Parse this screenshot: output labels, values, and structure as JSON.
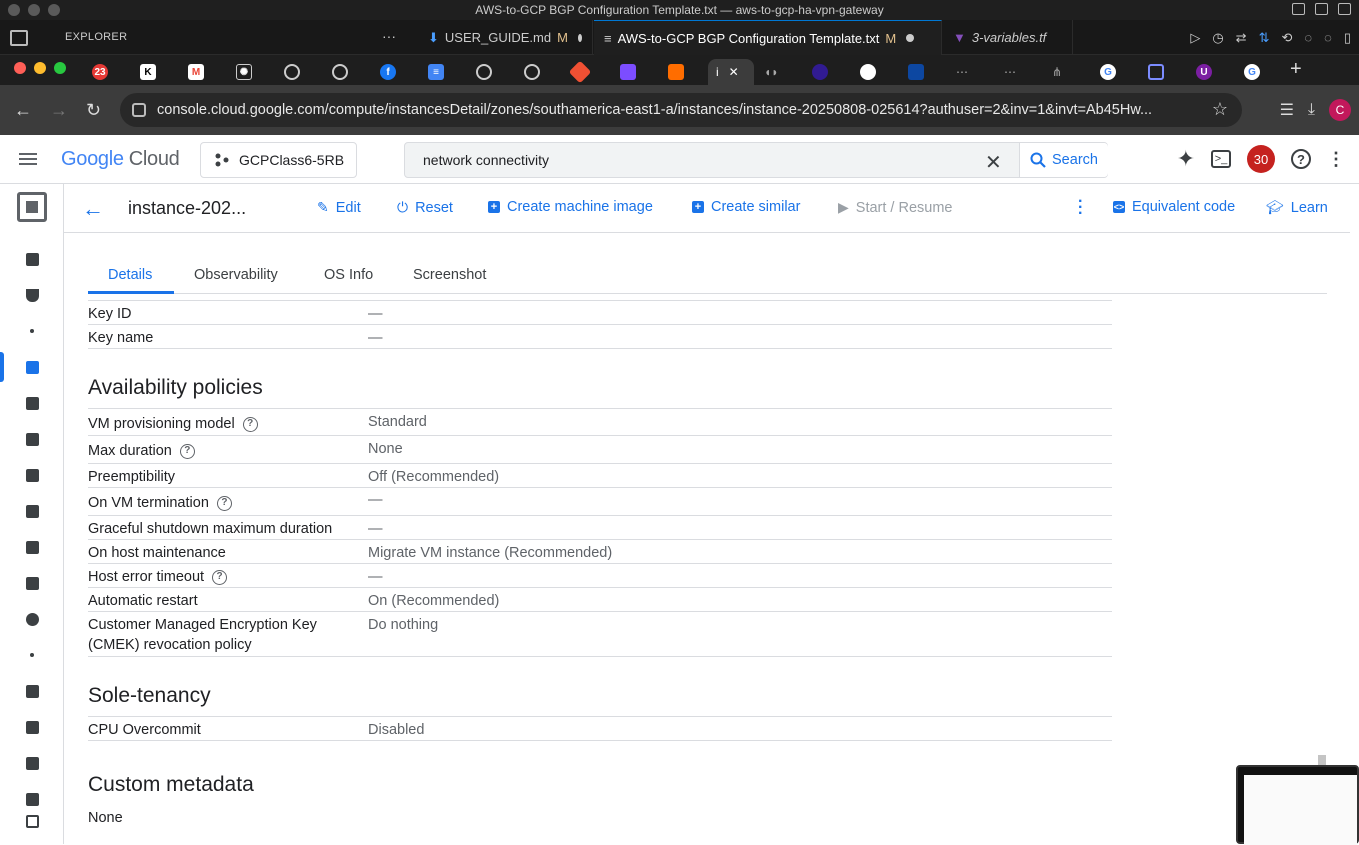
{
  "vscode": {
    "window_title": "AWS-to-GCP BGP Configuration Template.txt — aws-to-gcp-ha-vpn-gateway",
    "explorer_label": "EXPLORER",
    "tabs": [
      {
        "label": "USER_GUIDE.md",
        "status": "M"
      },
      {
        "label": "AWS-to-GCP BGP Configuration Template.txt",
        "status": "M"
      },
      {
        "label": "3-variables.tf",
        "status": ""
      }
    ]
  },
  "chrome": {
    "url": "console.cloud.google.com/compute/instancesDetail/zones/southamerica-east1-a/instances/instance-20250808-025614?authuser=2&inv=1&invt=Ab45Hw...",
    "profile_initial": "C",
    "active_tab_label": "i",
    "badge_count": "23",
    "colors": {
      "profile": "#c2185b",
      "tab_bar": "#1e1e1e",
      "toolbar": "#3c3c3c"
    }
  },
  "console": {
    "logo_google": "Google",
    "logo_cloud": "Cloud",
    "project": "GCPClass6-5RB",
    "search_value": "network connectivity",
    "search_button": "Search",
    "notifications": "30"
  },
  "toolbar": {
    "instance_title": "instance-202...",
    "edit": "Edit",
    "reset": "Reset",
    "create_machine_image": "Create machine image",
    "create_similar": "Create similar",
    "start_resume": "Start / Resume",
    "equivalent_code": "Equivalent code",
    "learn": "Learn"
  },
  "tabs": {
    "details": "Details",
    "observability": "Observability",
    "os_info": "OS Info",
    "screenshot": "Screenshot"
  },
  "encryption": {
    "key_id_label": "Key ID",
    "key_id_value": "—",
    "key_name_label": "Key name",
    "key_name_value": "—"
  },
  "availability": {
    "title": "Availability policies",
    "rows": [
      {
        "label": "VM provisioning model",
        "value": "Standard",
        "help": true
      },
      {
        "label": "Max duration",
        "value": "None",
        "help": true
      },
      {
        "label": "Preemptibility",
        "value": "Off (Recommended)",
        "help": false
      },
      {
        "label": "On VM termination",
        "value": "—",
        "help": true
      },
      {
        "label": "Graceful shutdown maximum duration",
        "value": "—",
        "help": false
      },
      {
        "label": "On host maintenance",
        "value": "Migrate VM instance (Recommended)",
        "help": false
      },
      {
        "label": "Host error timeout",
        "value": "—",
        "help": true
      },
      {
        "label": "Automatic restart",
        "value": "On (Recommended)",
        "help": false
      },
      {
        "label_line1": "Customer Managed Encryption Key",
        "label_line2": "(CMEK) revocation policy",
        "value": "Do nothing",
        "help": false
      }
    ]
  },
  "sole_tenancy": {
    "title": "Sole-tenancy",
    "cpu_overcommit_label": "CPU Overcommit",
    "cpu_overcommit_value": "Disabled"
  },
  "custom_metadata": {
    "title": "Custom metadata",
    "value": "None"
  },
  "icons": [
    "back-arrow-icon",
    "pencil-icon",
    "power-icon",
    "add-box-icon",
    "play-icon",
    "more-vert-icon",
    "code-icon",
    "school-icon",
    "help-icon",
    "search-icon",
    "close-icon",
    "gemini-icon",
    "terminal-icon",
    "apps-icon"
  ],
  "accent_color": "#1a73e8"
}
